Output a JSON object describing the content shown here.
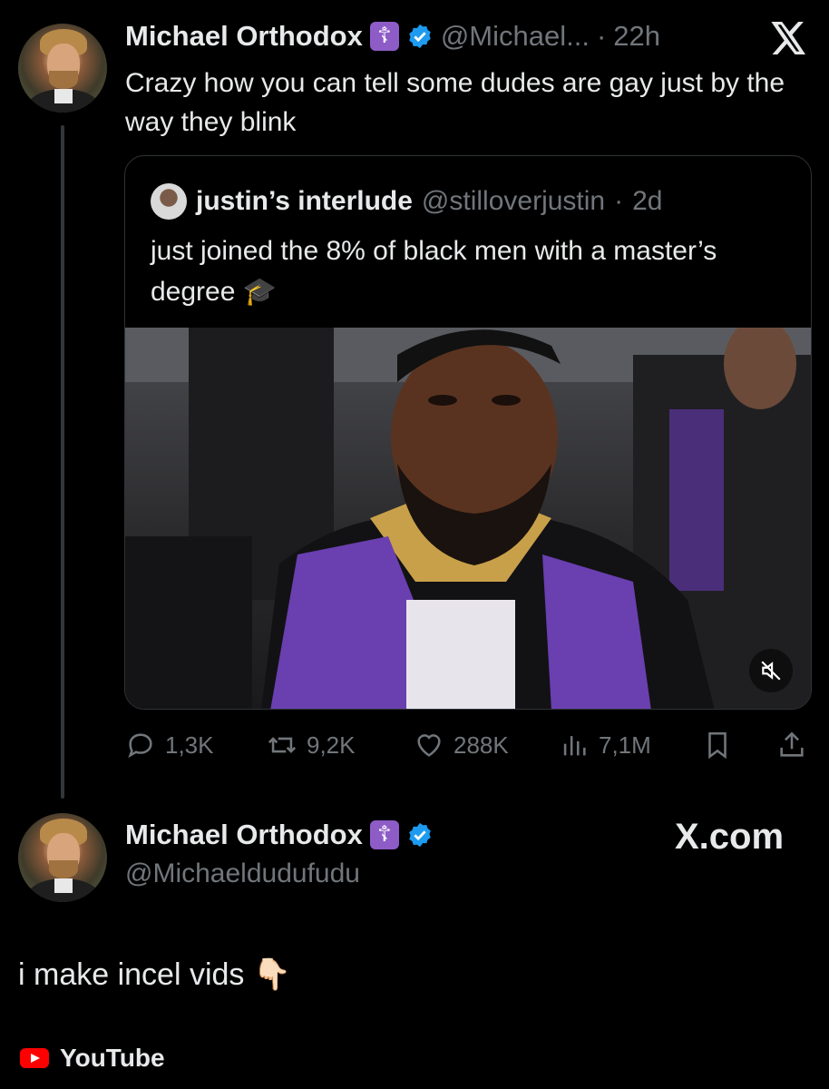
{
  "tweet": {
    "author_name": "Michael Orthodox",
    "cross_badge": "☦",
    "handle": "@Michael...",
    "separator": "·",
    "time": "22h",
    "text": "Crazy how you can tell some dudes are gay just by the way they blink"
  },
  "quote": {
    "author_name": "justin’s interlude",
    "handle": "@stilloverjustin",
    "separator": "·",
    "time": "2d",
    "text": "just joined the 8% of black men with a master’s degree 🎓",
    "media_icon": "mute-icon"
  },
  "actions": {
    "replies": "1,3K",
    "reposts": "9,2K",
    "likes": "288K",
    "views": "7,1M"
  },
  "profile": {
    "name": "Michael Orthodox",
    "cross_badge": "☦",
    "handle": "@Michaeldudufudu",
    "site": "X.com",
    "bio": "i make incel vids 👇🏻",
    "link_label": "YouTube"
  },
  "colors": {
    "background": "#000000",
    "text": "#e7e9ea",
    "muted": "#71767b",
    "verified": "#1d9bf0",
    "cross_badge": "#8e5cc7",
    "youtube_red": "#ff0000"
  }
}
